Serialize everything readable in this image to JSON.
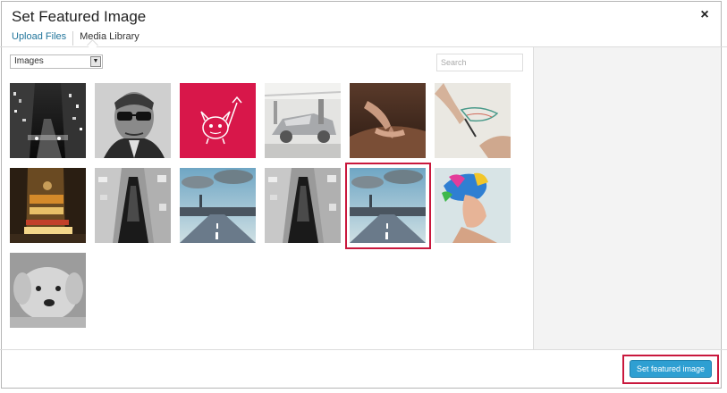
{
  "modal": {
    "title": "Set Featured Image",
    "close_label": "×"
  },
  "tabs": [
    {
      "label": "Upload Files",
      "active": false
    },
    {
      "label": "Media Library",
      "active": true
    }
  ],
  "filter": {
    "selected": "Images",
    "arrow": "▼"
  },
  "search": {
    "placeholder": "Search"
  },
  "grid": {
    "selected_index": 10,
    "items": [
      {
        "name": "city-street-night-bw"
      },
      {
        "name": "man-sunglasses-portrait"
      },
      {
        "name": "red-devil-cartoon"
      },
      {
        "name": "car-factory"
      },
      {
        "name": "hands-sculpting"
      },
      {
        "name": "hand-drawing-sketch"
      },
      {
        "name": "times-square-night"
      },
      {
        "name": "skyscraper-aerial-bw"
      },
      {
        "name": "london-road-big-ben"
      },
      {
        "name": "skyscraper-aerial-bw-2"
      },
      {
        "name": "london-road-big-ben-2"
      },
      {
        "name": "colorful-woman-portrait"
      },
      {
        "name": "puppy-bw"
      }
    ]
  },
  "footer": {
    "button_label": "Set featured image"
  },
  "colors": {
    "accent": "#21759b",
    "button": "#2e9fd2",
    "highlight": "#c9183d"
  }
}
